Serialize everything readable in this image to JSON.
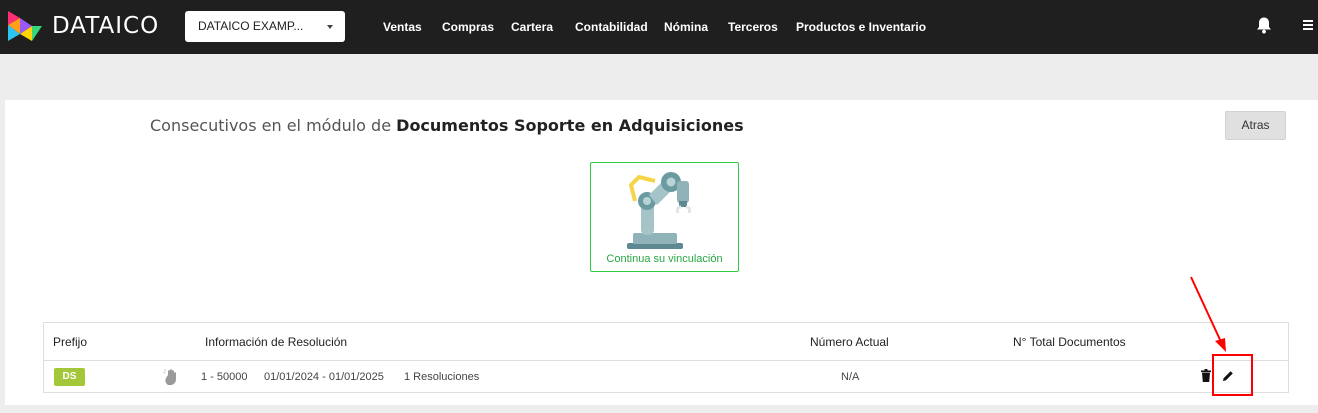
{
  "brand": {
    "name": "DATAICO"
  },
  "company_select": {
    "value": "DATAICO EXAMP..."
  },
  "nav": [
    {
      "label": "Ventas"
    },
    {
      "label": "Compras"
    },
    {
      "label": "Cartera"
    },
    {
      "label": "Contabilidad"
    },
    {
      "label": "Nómina"
    },
    {
      "label": "Terceros"
    },
    {
      "label": "Productos e Inventario"
    }
  ],
  "icons": {
    "logo": "dataico-logo-icon",
    "notifications": "bell-icon",
    "menu": "menu-icon",
    "caret": "caret-down-icon",
    "link": "robot-arm-icon",
    "hand": "hand-icon",
    "delete": "trash-icon",
    "edit": "pencil-icon"
  },
  "page": {
    "title_prefix": "Consecutivos en el módulo de",
    "title_module": "Documentos Soporte en Adquisiciones",
    "back_label": "Atras",
    "link_label": "Continua su vinculación"
  },
  "table": {
    "headers": {
      "prefix": "Prefijo",
      "resolution": "Información de Resolución",
      "current": "Número Actual",
      "total": "N° Total Documentos"
    },
    "rows": [
      {
        "prefix": "DS",
        "range": "1 - 50000",
        "dates": "01/01/2024 - 01/01/2025",
        "resolutions": "1 Resoluciones",
        "current": "N/A",
        "total": ""
      }
    ]
  },
  "colors": {
    "topbar": "#1f1f1f",
    "badge": "#a4c639",
    "link_green": "#28a745",
    "annotation": "#ff0000"
  }
}
